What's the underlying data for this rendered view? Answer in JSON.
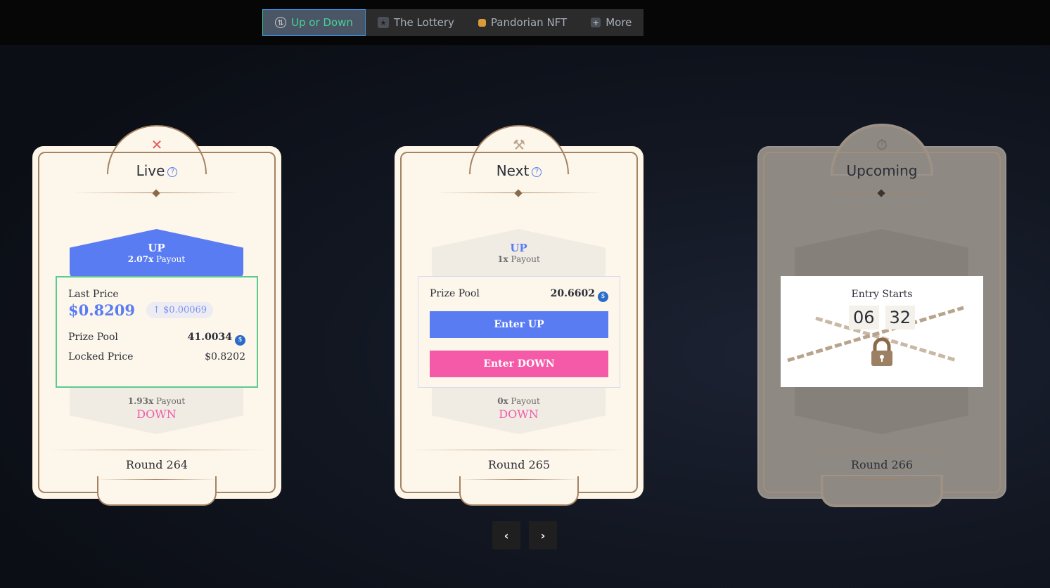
{
  "nav": {
    "items": [
      {
        "label": "Up or Down",
        "icon": "up-down-icon",
        "active": true
      },
      {
        "label": "The Lottery",
        "icon": "lottery-icon"
      },
      {
        "label": "Pandorian NFT",
        "icon": "nft-icon"
      },
      {
        "label": "More",
        "icon": "plus-icon"
      }
    ]
  },
  "cards": [
    {
      "status": "Live",
      "icon": "swords-icon",
      "up_label": "UP",
      "up_payout_mult": "2.07x",
      "payout": "Payout",
      "last_price_label": "Last Price",
      "last_price": "$0.8209",
      "price_change": "$0.00069",
      "prize_pool_label": "Prize Pool",
      "prize_pool": "41.0034",
      "locked_price_label": "Locked Price",
      "locked_price": "$0.8202",
      "down_payout_mult": "1.93x",
      "down_label": "DOWN",
      "round": "Round 264"
    },
    {
      "status": "Next",
      "icon": "hammer-icon",
      "up_label": "UP",
      "up_payout_mult": "1x",
      "payout": "Payout",
      "prize_pool_label": "Prize Pool",
      "prize_pool": "20.6602",
      "enter_up": "Enter UP",
      "enter_down": "Enter DOWN",
      "down_payout_mult": "0x",
      "down_label": "DOWN",
      "round": "Round 265"
    },
    {
      "status": "Upcoming",
      "icon": "timer-icon",
      "entry_label": "Entry Starts",
      "minutes": "06",
      "seconds": "32",
      "round": "Round 266"
    }
  ],
  "colors": {
    "up": "#5a7cf2",
    "down": "#f05aa8",
    "accent": "#46d39a",
    "card": "#fdf6ea",
    "border": "#a48363"
  }
}
